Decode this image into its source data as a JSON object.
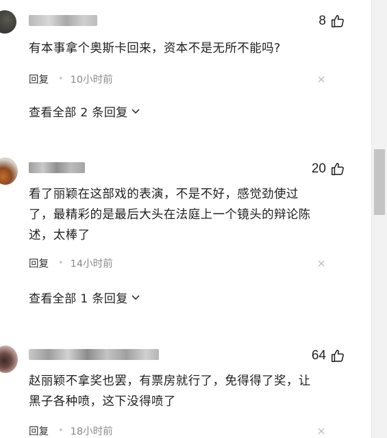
{
  "comments": [
    {
      "likes": "8",
      "text": "有本事拿个奥斯卡回来，资本不是无所不能吗?",
      "reply_label": "回复",
      "time": "10小时前",
      "view_replies": "查看全部 2 条回复"
    },
    {
      "likes": "20",
      "text_lines": [
        "看了丽颖在这部戏的表演，不是不好，感觉劲使过",
        "了，最精彩的是最后大头在法庭上一个镜头的辩论陈",
        "述，太棒了"
      ],
      "reply_label": "回复",
      "time": "14小时前",
      "view_replies": "查看全部 1 条回复"
    },
    {
      "likes": "64",
      "text_lines": [
        "赵丽颖不拿奖也罢，有票房就行了，免得得了奖，让",
        "黑子各种喷，这下没得喷了"
      ],
      "reply_label": "回复",
      "time": "18小时前"
    }
  ],
  "icons": {
    "like": "thumbs-up-icon",
    "close": "close-icon",
    "expand": "chevron-down-icon"
  },
  "colors": {
    "text": "#1f1f1f",
    "meta": "#8a8a8a",
    "background": "#ffffff"
  }
}
